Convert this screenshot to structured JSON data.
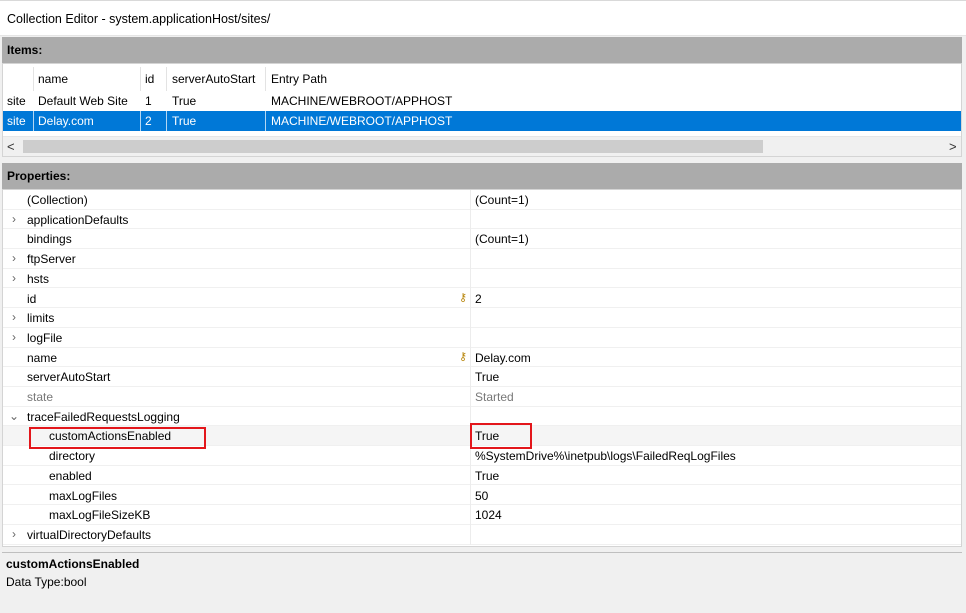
{
  "window": {
    "title": "Collection Editor - system.applicationHost/sites/"
  },
  "items": {
    "header": "Items:",
    "columns": [
      "name",
      "id",
      "serverAutoStart",
      "Entry Path"
    ],
    "rows": [
      {
        "type": "site",
        "name": "Default Web Site",
        "id": "1",
        "serverAutoStart": "True",
        "entry_path": "MACHINE/WEBROOT/APPHOST",
        "selected": false
      },
      {
        "type": "site",
        "name": "Delay.com",
        "id": "2",
        "serverAutoStart": "True",
        "entry_path": "MACHINE/WEBROOT/APPHOST",
        "selected": true
      }
    ],
    "scroll_left_glyph": "<",
    "scroll_right_glyph": ">"
  },
  "properties": {
    "header": "Properties:",
    "rows": [
      {
        "name": "(Collection)",
        "value": "(Count=1)"
      },
      {
        "name": "applicationDefaults",
        "value": "",
        "expander": "›"
      },
      {
        "name": "bindings",
        "value": "(Count=1)"
      },
      {
        "name": "ftpServer",
        "value": "",
        "expander": "›"
      },
      {
        "name": "hsts",
        "value": "",
        "expander": "›"
      },
      {
        "name": "id",
        "value": "2",
        "key": true
      },
      {
        "name": "limits",
        "value": "",
        "expander": "›"
      },
      {
        "name": "logFile",
        "value": "",
        "expander": "›"
      },
      {
        "name": "name",
        "value": "Delay.com",
        "key": true
      },
      {
        "name": "serverAutoStart",
        "value": "True"
      },
      {
        "name": "state",
        "value": "Started",
        "readonly": true
      },
      {
        "name": "traceFailedRequestsLogging",
        "value": "",
        "expander": "⌄"
      },
      {
        "name": "customActionsEnabled",
        "value": "True",
        "child": true,
        "highlight": true
      },
      {
        "name": "directory",
        "value": "%SystemDrive%\\inetpub\\logs\\FailedReqLogFiles",
        "child": true
      },
      {
        "name": "enabled",
        "value": "True",
        "child": true
      },
      {
        "name": "maxLogFiles",
        "value": "50",
        "child": true
      },
      {
        "name": "maxLogFileSizeKB",
        "value": "1024",
        "child": true
      },
      {
        "name": "virtualDirectoryDefaults",
        "value": "",
        "expander": "›"
      }
    ]
  },
  "description": {
    "title": "customActionsEnabled",
    "text": "Data Type:bool"
  },
  "colors": {
    "selection": "#0078d7",
    "highlight_box": "#e3161b",
    "section_header": "#ababab"
  }
}
